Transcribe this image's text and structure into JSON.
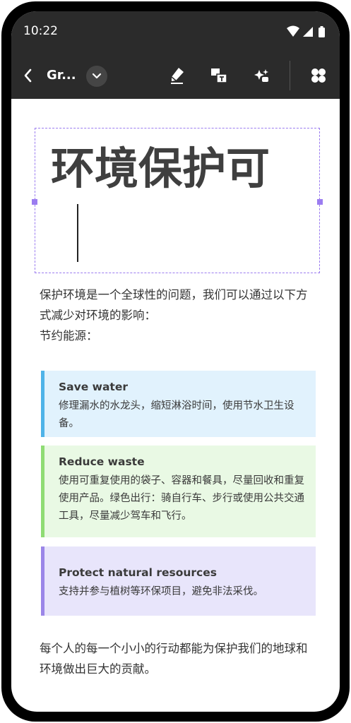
{
  "status_bar": {
    "time": "10:22"
  },
  "toolbar": {
    "doc_title": "Gr...",
    "colors": {
      "background": "#2b2b2b",
      "foreground": "#ffffff"
    }
  },
  "document": {
    "heading": "环境保护可",
    "intro": "保护环境是一个全球性的问题，我们可以通过以下方式减少对环境的影响：",
    "section_label": "节约能源：",
    "callouts": [
      {
        "title": "Save water",
        "body": "修理漏水的水龙头，缩短淋浴时间，使用节水卫生设备。",
        "bg": "#e1f2fd",
        "accent": "#4fb3e8"
      },
      {
        "title": "Reduce waste",
        "body": "使用可重复使用的袋子、容器和餐具，尽量回收和重复使用产品。绿色出行：骑自行车、步行或使用公共交通工具，尽量减少驾车和飞行。",
        "bg": "#e9f9e4",
        "accent": "#8fdc74"
      },
      {
        "title": "Protect natural resources",
        "body": "支持并参与植树等环保项目，避免非法采伐。",
        "bg": "#e8e5fb",
        "accent": "#9b86e8"
      }
    ],
    "closing": "每个人的每一个小小的行动都能为保护我们的地球和环境做出巨大的贡献。"
  },
  "icons": {
    "back": "chevron-left-icon",
    "dropdown": "chevron-down-icon",
    "pen": "pen-icon",
    "translate": "translate-icon",
    "ai": "sparkle-icon",
    "apps": "four-leaf-grid-icon"
  },
  "selection_color": "#9b7cf0"
}
